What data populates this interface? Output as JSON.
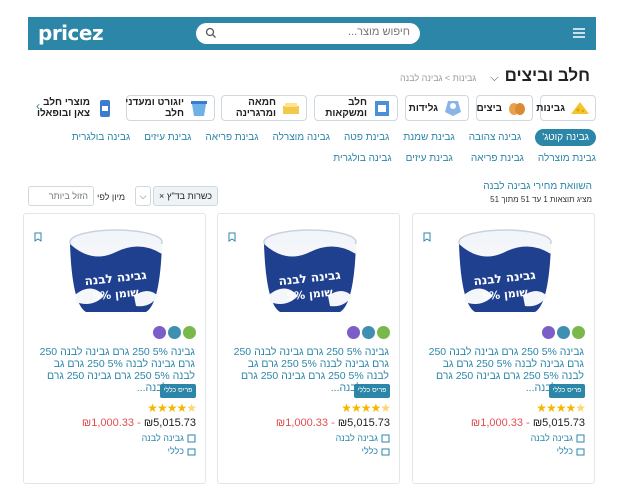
{
  "header": {
    "logo": "pricez",
    "search_placeholder": "חיפוש מוצר..."
  },
  "page": {
    "title": "חלב וביצים",
    "breadcrumb": "גבינות  >  גבינה לבנה"
  },
  "categories": [
    {
      "label": "גבינות",
      "icon_color": "#f4c430"
    },
    {
      "label": "ביצים",
      "icon_color": "#e8a04a"
    },
    {
      "label": "גלידות",
      "icon_color": "#8ab4e8"
    },
    {
      "label": "חלב\nומשקאות",
      "icon_color": "#4b8fd9"
    },
    {
      "label": "חמאה\nומרגרינה",
      "icon_color": "#f2c94c"
    },
    {
      "label": "יוגורט ומעדני\nחלב",
      "icon_color": "#6fb1e6"
    },
    {
      "label": "מוצרי חלב\nצאן ובופאלו",
      "icon_color": "#3b7bd0"
    }
  ],
  "subcategories": {
    "active": "גבינה קוטג'",
    "items": [
      "גבינה צהובה",
      "גבינת שמנת",
      "גבינת פטה",
      "גבינה מוצרלה",
      "גבינת פריאה",
      "גבינת עיזים",
      "גבינה בולגרית",
      "גבינת מוצרלה",
      "גבינת פריאה",
      "גבינת עיזים",
      "גבינה בולגרית"
    ]
  },
  "results": {
    "section_title": "השוואת מחירי גבינה לבנה",
    "count_text": "מציג תוצאות 1 עד 51 מתוך 51"
  },
  "filters": {
    "chip": "כשרות בד\"ץ",
    "chip_close": "×",
    "sort_label": "מיון לפי",
    "sort_value": "הזול ביותר",
    "extra_box": "⌵"
  },
  "products": [
    {
      "name": "גבינה 5% 250 גרם גבינה לבנה 250 גרם גבינה לבנה 5% 250 גרם גב לבנה 5% 250 גרם גבינה 250 גרם גבינה לבנה...",
      "store_button": "פריס כללי",
      "rating": 4.5,
      "price_low": "₪1,000.33",
      "price_high": "₪5,015.73",
      "brand": "גבינה לבנה",
      "category": "כללי"
    },
    {
      "name": "גבינה 5% 250 גרם גבינה לבנה 250 גרם גבינה לבנה 5% 250 גרם גב לבנה 5% 250 גרם גבינה 250 גרם גבינה לבנה...",
      "store_button": "פריס כללי",
      "rating": 4.5,
      "price_low": "₪1,000.33",
      "price_high": "₪5,015.73",
      "brand": "גבינה לבנה",
      "category": "כללי"
    },
    {
      "name": "גבינה 5% 250 גרם גבינה לבנה 250 גרם גבינה לבנה 5% 250 גרם גב לבנה 5% 250 גרם גבינה 250 גרם גבינה לבנה...",
      "store_button": "פריס כללי",
      "rating": 4.5,
      "price_low": "₪1,000.33",
      "price_high": "₪5,015.73",
      "brand": "גבינה לבנה",
      "category": "כללי"
    }
  ],
  "product_image": {
    "label": "גבינה לבנה",
    "sublabel": "5% שומן",
    "tub_color": "#1f3f8f"
  },
  "colors": {
    "brand": "#2b86a8",
    "price_low": "#e05050",
    "star": "#f5b800"
  }
}
